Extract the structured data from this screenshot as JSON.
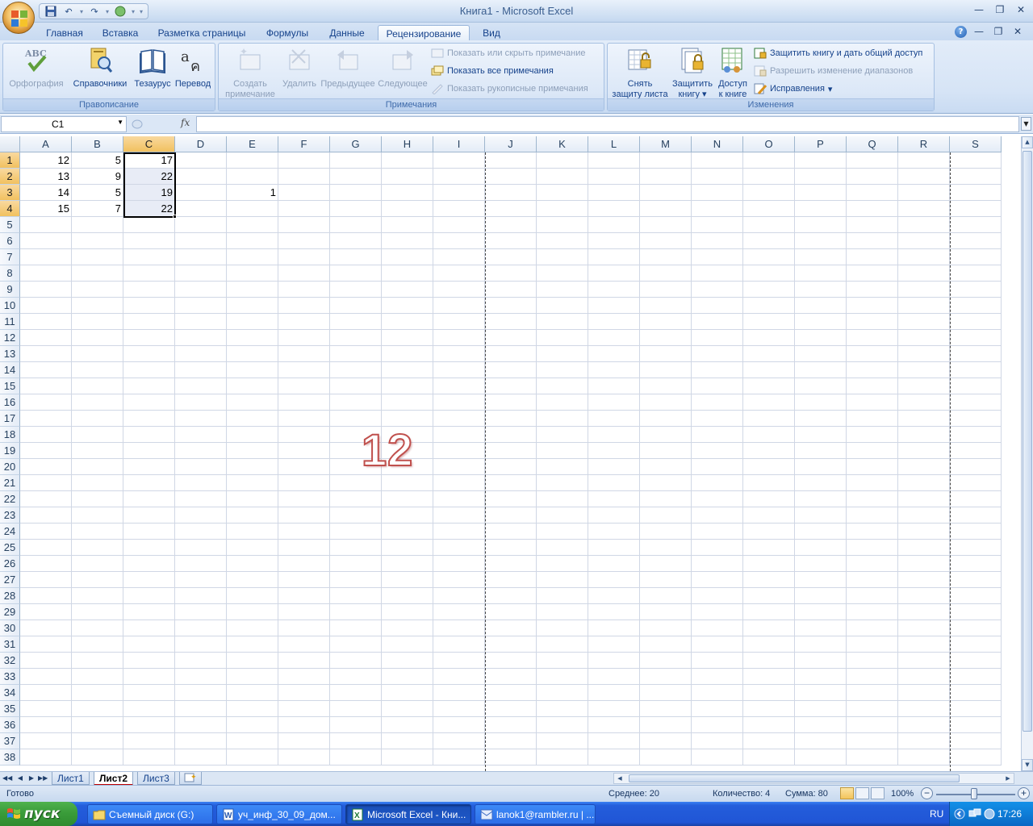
{
  "window": {
    "title": "Книга1 - Microsoft Excel"
  },
  "ribbon_tabs": [
    "Главная",
    "Вставка",
    "Разметка страницы",
    "Формулы",
    "Данные",
    "Рецензирование",
    "Вид"
  ],
  "active_tab": "Рецензирование",
  "groups": {
    "spelling": {
      "label": "Правописание",
      "buttons": [
        "Орфография",
        "Справочники",
        "Тезаурус",
        "Перевод"
      ]
    },
    "comments": {
      "label": "Примечания",
      "create": [
        "Создать",
        "примечание"
      ],
      "delete": "Удалить",
      "previous": "Предыдущее",
      "next": "Следующее",
      "show_hide": "Показать или скрыть примечание",
      "show_all": "Показать все примечания",
      "show_ink": "Показать рукописные примечания"
    },
    "changes": {
      "label": "Изменения",
      "unprotect": [
        "Снять",
        "защиту листа"
      ],
      "protect_book": [
        "Защитить",
        "книгу"
      ],
      "share": [
        "Доступ",
        "к книге"
      ],
      "protect_share": "Защитить книгу и дать общий доступ",
      "allow_ranges": "Разрешить изменение диапазонов",
      "track": "Исправления"
    }
  },
  "formula_bar": {
    "name_box": "C1",
    "fx": "fx",
    "formula": ""
  },
  "columns": [
    "A",
    "B",
    "C",
    "D",
    "E",
    "F",
    "G",
    "H",
    "I",
    "J",
    "K",
    "L",
    "M",
    "N",
    "O",
    "P",
    "Q",
    "R",
    "S"
  ],
  "selected_column": "C",
  "rows_visible": 38,
  "cells": {
    "A1": "12",
    "B1": "5",
    "C1": "17",
    "A2": "13",
    "B2": "9",
    "C2": "22",
    "A3": "14",
    "B3": "5",
    "C3": "19",
    "E3": "1",
    "A4": "15",
    "B4": "7",
    "C4": "22"
  },
  "overlay_text": "12",
  "sheets": [
    "Лист1",
    "Лист2",
    "Лист3"
  ],
  "active_sheet": "Лист2",
  "status": {
    "ready": "Готово",
    "average": "Среднее: 20",
    "count": "Количество: 4",
    "sum": "Сумма: 80",
    "zoom": "100%"
  },
  "taskbar": {
    "start": "пуск",
    "tasks": [
      "Съемный диск (G:)",
      "уч_инф_30_09_дом...",
      "Microsoft Excel - Кни...",
      "lanok1@rambler.ru | ..."
    ],
    "active_task_index": 2,
    "lang": "RU",
    "clock": "17:26"
  }
}
